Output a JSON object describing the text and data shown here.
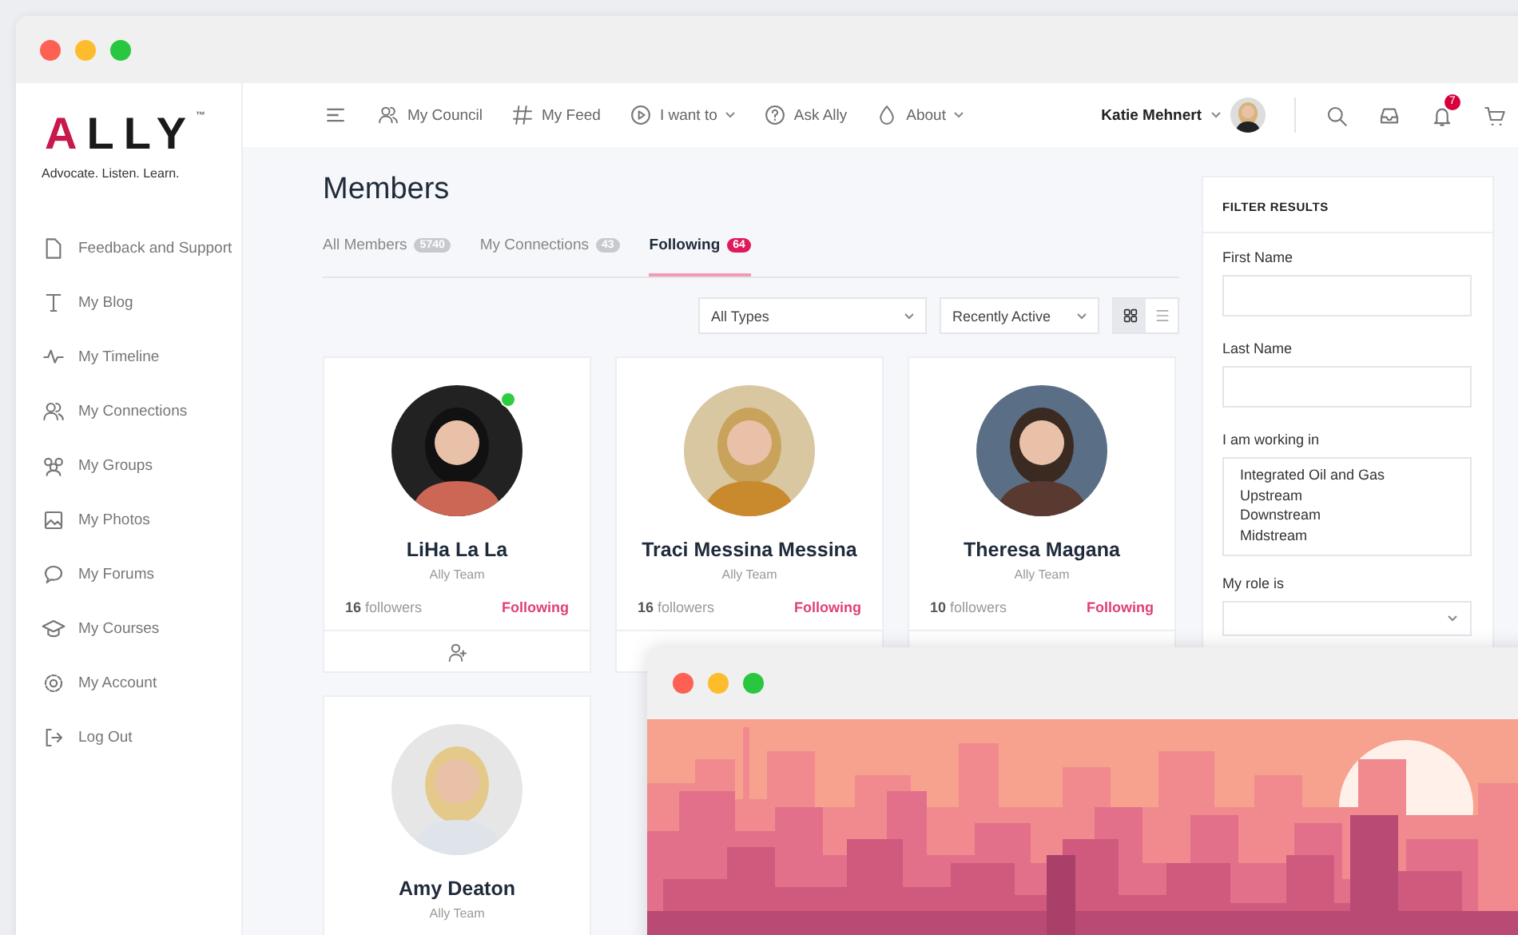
{
  "logo": {
    "text": "ALLY",
    "tm": "™",
    "tagline": "Advocate. Listen. Learn."
  },
  "sidebar": {
    "items": [
      {
        "label": "Feedback and Support"
      },
      {
        "label": "My Blog"
      },
      {
        "label": "My Timeline"
      },
      {
        "label": "My Connections"
      },
      {
        "label": "My Groups"
      },
      {
        "label": "My Photos"
      },
      {
        "label": "My Forums"
      },
      {
        "label": "My Courses"
      },
      {
        "label": "My Account"
      },
      {
        "label": "Log Out"
      }
    ]
  },
  "nav": {
    "items": [
      {
        "label": "My Council",
        "dropdown": false
      },
      {
        "label": "My Feed",
        "dropdown": false
      },
      {
        "label": "I want to",
        "dropdown": true
      },
      {
        "label": "Ask Ally",
        "dropdown": false
      },
      {
        "label": "About",
        "dropdown": true
      }
    ],
    "user": "Katie Mehnert",
    "notifications": "7"
  },
  "page": {
    "title": "Members",
    "tabs": [
      {
        "label": "All Members",
        "count": "5740",
        "selected": false
      },
      {
        "label": "My Connections",
        "count": "43",
        "selected": false
      },
      {
        "label": "Following",
        "count": "64",
        "selected": true
      }
    ],
    "filters": [
      {
        "value": "All Types"
      },
      {
        "value": "Recently Active"
      }
    ],
    "view": [
      {
        "kind": "grid",
        "selected": true
      },
      {
        "kind": "list",
        "selected": false
      }
    ],
    "members": [
      {
        "name": "LiHa La La",
        "team": "Ally Team",
        "followers": "**16** followers",
        "action": "Following",
        "online": true,
        "connect_button": true
      },
      {
        "name": "Traci Messina Messina",
        "team": "Ally Team",
        "followers": "**16** followers",
        "action": "Following",
        "online": false
      },
      {
        "name": "Theresa Magana",
        "team": "Ally Team",
        "followers": "**10** followers",
        "action": "Following",
        "online": false
      },
      {
        "name": "Amy Deaton",
        "team": "Ally Team",
        "online": false
      }
    ]
  },
  "filter_panel": {
    "title": "FILTER RESULTS",
    "fields": [
      {
        "kind": "input",
        "label": "First Name"
      },
      {
        "kind": "input",
        "label": "Last Name"
      },
      {
        "kind": "listbox",
        "label": "I am working in",
        "options": [
          "Integrated Oil and Gas",
          "Upstream",
          "Downstream",
          "Midstream"
        ]
      },
      {
        "kind": "select",
        "label": "My role is"
      }
    ]
  }
}
